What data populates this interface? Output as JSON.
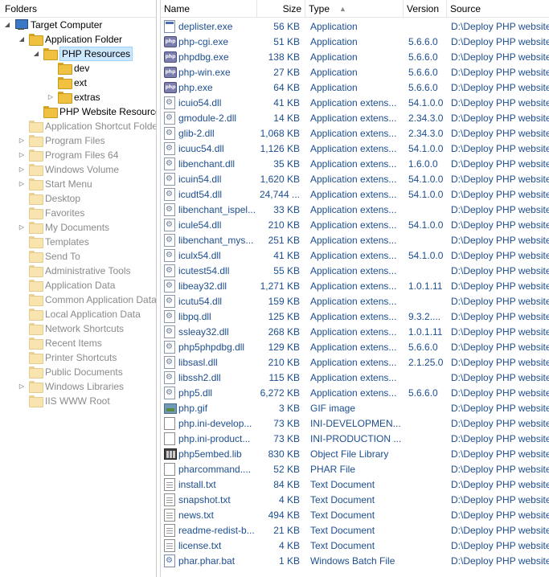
{
  "left_pane": {
    "header": "Folders",
    "tree": [
      {
        "label": "Target Computer",
        "indent": 0,
        "arrow": "expanded",
        "icon": "computer-icon",
        "faded": false,
        "selected": false
      },
      {
        "label": "Application Folder",
        "indent": 1,
        "arrow": "expanded",
        "icon": "folder-icon",
        "faded": false,
        "selected": false
      },
      {
        "label": "PHP Resources",
        "indent": 2,
        "arrow": "expanded",
        "icon": "folder-open-icon",
        "faded": false,
        "selected": true
      },
      {
        "label": "dev",
        "indent": 3,
        "arrow": "none",
        "icon": "folder-icon",
        "faded": false,
        "selected": false
      },
      {
        "label": "ext",
        "indent": 3,
        "arrow": "none",
        "icon": "folder-icon",
        "faded": false,
        "selected": false
      },
      {
        "label": "extras",
        "indent": 3,
        "arrow": "collapsed",
        "icon": "folder-icon",
        "faded": false,
        "selected": false
      },
      {
        "label": "PHP Website Resources",
        "indent": 2,
        "arrow": "none",
        "icon": "folder-icon",
        "faded": false,
        "selected": false
      },
      {
        "label": "Application Shortcut Folder",
        "indent": 1,
        "arrow": "none",
        "icon": "folder-icon",
        "faded": true,
        "selected": false
      },
      {
        "label": "Program Files",
        "indent": 1,
        "arrow": "collapsed",
        "icon": "folder-icon",
        "faded": true,
        "selected": false
      },
      {
        "label": "Program Files 64",
        "indent": 1,
        "arrow": "collapsed",
        "icon": "folder-icon",
        "faded": true,
        "selected": false
      },
      {
        "label": "Windows Volume",
        "indent": 1,
        "arrow": "collapsed",
        "icon": "folder-icon",
        "faded": true,
        "selected": false
      },
      {
        "label": "Start Menu",
        "indent": 1,
        "arrow": "collapsed",
        "icon": "folder-icon",
        "faded": true,
        "selected": false
      },
      {
        "label": "Desktop",
        "indent": 1,
        "arrow": "none",
        "icon": "folder-icon",
        "faded": true,
        "selected": false
      },
      {
        "label": "Favorites",
        "indent": 1,
        "arrow": "none",
        "icon": "folder-icon",
        "faded": true,
        "selected": false
      },
      {
        "label": "My Documents",
        "indent": 1,
        "arrow": "collapsed",
        "icon": "folder-icon",
        "faded": true,
        "selected": false
      },
      {
        "label": "Templates",
        "indent": 1,
        "arrow": "none",
        "icon": "folder-icon",
        "faded": true,
        "selected": false
      },
      {
        "label": "Send To",
        "indent": 1,
        "arrow": "none",
        "icon": "folder-icon",
        "faded": true,
        "selected": false
      },
      {
        "label": "Administrative Tools",
        "indent": 1,
        "arrow": "none",
        "icon": "folder-icon",
        "faded": true,
        "selected": false
      },
      {
        "label": "Application Data",
        "indent": 1,
        "arrow": "none",
        "icon": "folder-icon",
        "faded": true,
        "selected": false
      },
      {
        "label": "Common Application Data",
        "indent": 1,
        "arrow": "none",
        "icon": "folder-icon",
        "faded": true,
        "selected": false
      },
      {
        "label": "Local Application Data",
        "indent": 1,
        "arrow": "none",
        "icon": "folder-icon",
        "faded": true,
        "selected": false
      },
      {
        "label": "Network Shortcuts",
        "indent": 1,
        "arrow": "none",
        "icon": "folder-icon",
        "faded": true,
        "selected": false
      },
      {
        "label": "Recent Items",
        "indent": 1,
        "arrow": "none",
        "icon": "folder-icon",
        "faded": true,
        "selected": false
      },
      {
        "label": "Printer Shortcuts",
        "indent": 1,
        "arrow": "none",
        "icon": "folder-icon",
        "faded": true,
        "selected": false
      },
      {
        "label": "Public Documents",
        "indent": 1,
        "arrow": "none",
        "icon": "folder-icon",
        "faded": true,
        "selected": false
      },
      {
        "label": "Windows Libraries",
        "indent": 1,
        "arrow": "collapsed",
        "icon": "folder-icon",
        "faded": true,
        "selected": false
      },
      {
        "label": "IIS WWW Root",
        "indent": 1,
        "arrow": "none",
        "icon": "folder-icon",
        "faded": true,
        "selected": false
      }
    ]
  },
  "file_list": {
    "columns": {
      "name": "Name",
      "size": "Size",
      "type": "Type",
      "version": "Version",
      "source": "Source"
    },
    "sorted_by": "type",
    "rows": [
      {
        "icon": "exe",
        "name": "deplister.exe",
        "size": "56 KB",
        "type": "Application",
        "version": "",
        "source": "D:\\Deploy PHP website"
      },
      {
        "icon": "php",
        "name": "php-cgi.exe",
        "size": "51 KB",
        "type": "Application",
        "version": "5.6.6.0",
        "source": "D:\\Deploy PHP website"
      },
      {
        "icon": "php",
        "name": "phpdbg.exe",
        "size": "138 KB",
        "type": "Application",
        "version": "5.6.6.0",
        "source": "D:\\Deploy PHP website"
      },
      {
        "icon": "php",
        "name": "php-win.exe",
        "size": "27 KB",
        "type": "Application",
        "version": "5.6.6.0",
        "source": "D:\\Deploy PHP website"
      },
      {
        "icon": "php",
        "name": "php.exe",
        "size": "64 KB",
        "type": "Application",
        "version": "5.6.6.0",
        "source": "D:\\Deploy PHP website"
      },
      {
        "icon": "dll",
        "name": "icuio54.dll",
        "size": "41 KB",
        "type": "Application extens...",
        "version": "54.1.0.0",
        "source": "D:\\Deploy PHP website"
      },
      {
        "icon": "dll",
        "name": "gmodule-2.dll",
        "size": "14 KB",
        "type": "Application extens...",
        "version": "2.34.3.0",
        "source": "D:\\Deploy PHP website"
      },
      {
        "icon": "dll",
        "name": "glib-2.dll",
        "size": "1,068 KB",
        "type": "Application extens...",
        "version": "2.34.3.0",
        "source": "D:\\Deploy PHP website"
      },
      {
        "icon": "dll",
        "name": "icuuc54.dll",
        "size": "1,126 KB",
        "type": "Application extens...",
        "version": "54.1.0.0",
        "source": "D:\\Deploy PHP website"
      },
      {
        "icon": "dll",
        "name": "libenchant.dll",
        "size": "35 KB",
        "type": "Application extens...",
        "version": "1.6.0.0",
        "source": "D:\\Deploy PHP website"
      },
      {
        "icon": "dll",
        "name": "icuin54.dll",
        "size": "1,620 KB",
        "type": "Application extens...",
        "version": "54.1.0.0",
        "source": "D:\\Deploy PHP website"
      },
      {
        "icon": "dll",
        "name": "icudt54.dll",
        "size": "24,744 ...",
        "type": "Application extens...",
        "version": "54.1.0.0",
        "source": "D:\\Deploy PHP website"
      },
      {
        "icon": "dll",
        "name": "libenchant_ispel...",
        "size": "33 KB",
        "type": "Application extens...",
        "version": "",
        "source": "D:\\Deploy PHP website"
      },
      {
        "icon": "dll",
        "name": "icule54.dll",
        "size": "210 KB",
        "type": "Application extens...",
        "version": "54.1.0.0",
        "source": "D:\\Deploy PHP website"
      },
      {
        "icon": "dll",
        "name": "libenchant_mys...",
        "size": "251 KB",
        "type": "Application extens...",
        "version": "",
        "source": "D:\\Deploy PHP website"
      },
      {
        "icon": "dll",
        "name": "iculx54.dll",
        "size": "41 KB",
        "type": "Application extens...",
        "version": "54.1.0.0",
        "source": "D:\\Deploy PHP website"
      },
      {
        "icon": "dll",
        "name": "icutest54.dll",
        "size": "55 KB",
        "type": "Application extens...",
        "version": "",
        "source": "D:\\Deploy PHP website"
      },
      {
        "icon": "dll",
        "name": "libeay32.dll",
        "size": "1,271 KB",
        "type": "Application extens...",
        "version": "1.0.1.11",
        "source": "D:\\Deploy PHP website"
      },
      {
        "icon": "dll",
        "name": "icutu54.dll",
        "size": "159 KB",
        "type": "Application extens...",
        "version": "",
        "source": "D:\\Deploy PHP website"
      },
      {
        "icon": "dll",
        "name": "libpq.dll",
        "size": "125 KB",
        "type": "Application extens...",
        "version": "9.3.2....",
        "source": "D:\\Deploy PHP website"
      },
      {
        "icon": "dll",
        "name": "ssleay32.dll",
        "size": "268 KB",
        "type": "Application extens...",
        "version": "1.0.1.11",
        "source": "D:\\Deploy PHP website"
      },
      {
        "icon": "dll",
        "name": "php5phpdbg.dll",
        "size": "129 KB",
        "type": "Application extens...",
        "version": "5.6.6.0",
        "source": "D:\\Deploy PHP website"
      },
      {
        "icon": "dll",
        "name": "libsasl.dll",
        "size": "210 KB",
        "type": "Application extens...",
        "version": "2.1.25.0",
        "source": "D:\\Deploy PHP website"
      },
      {
        "icon": "dll",
        "name": "libssh2.dll",
        "size": "115 KB",
        "type": "Application extens...",
        "version": "",
        "source": "D:\\Deploy PHP website"
      },
      {
        "icon": "dll",
        "name": "php5.dll",
        "size": "6,272 KB",
        "type": "Application extens...",
        "version": "5.6.6.0",
        "source": "D:\\Deploy PHP website"
      },
      {
        "icon": "gif",
        "name": "php.gif",
        "size": "3 KB",
        "type": "GIF image",
        "version": "",
        "source": "D:\\Deploy PHP website"
      },
      {
        "icon": "doc",
        "name": "php.ini-develop...",
        "size": "73 KB",
        "type": "INI-DEVELOPMEN...",
        "version": "",
        "source": "D:\\Deploy PHP website"
      },
      {
        "icon": "doc",
        "name": "php.ini-product...",
        "size": "73 KB",
        "type": "INI-PRODUCTION ...",
        "version": "",
        "source": "D:\\Deploy PHP website"
      },
      {
        "icon": "lib",
        "name": "php5embed.lib",
        "size": "830 KB",
        "type": "Object File Library",
        "version": "",
        "source": "D:\\Deploy PHP website"
      },
      {
        "icon": "doc",
        "name": "pharcommand....",
        "size": "52 KB",
        "type": "PHAR File",
        "version": "",
        "source": "D:\\Deploy PHP website"
      },
      {
        "icon": "txt",
        "name": "install.txt",
        "size": "84 KB",
        "type": "Text Document",
        "version": "",
        "source": "D:\\Deploy PHP website"
      },
      {
        "icon": "txt",
        "name": "snapshot.txt",
        "size": "4 KB",
        "type": "Text Document",
        "version": "",
        "source": "D:\\Deploy PHP website"
      },
      {
        "icon": "txt",
        "name": "news.txt",
        "size": "494 KB",
        "type": "Text Document",
        "version": "",
        "source": "D:\\Deploy PHP website"
      },
      {
        "icon": "txt",
        "name": "readme-redist-b...",
        "size": "21 KB",
        "type": "Text Document",
        "version": "",
        "source": "D:\\Deploy PHP website"
      },
      {
        "icon": "txt",
        "name": "license.txt",
        "size": "4 KB",
        "type": "Text Document",
        "version": "",
        "source": "D:\\Deploy PHP website"
      },
      {
        "icon": "bat",
        "name": "phar.phar.bat",
        "size": "1 KB",
        "type": "Windows Batch File",
        "version": "",
        "source": "D:\\Deploy PHP website"
      }
    ]
  },
  "colors": {
    "link_text": "#1d4e8f",
    "faded_text": "#8a8a8a",
    "selection_bg": "#cce8ff",
    "selection_border": "#99d1ff"
  }
}
